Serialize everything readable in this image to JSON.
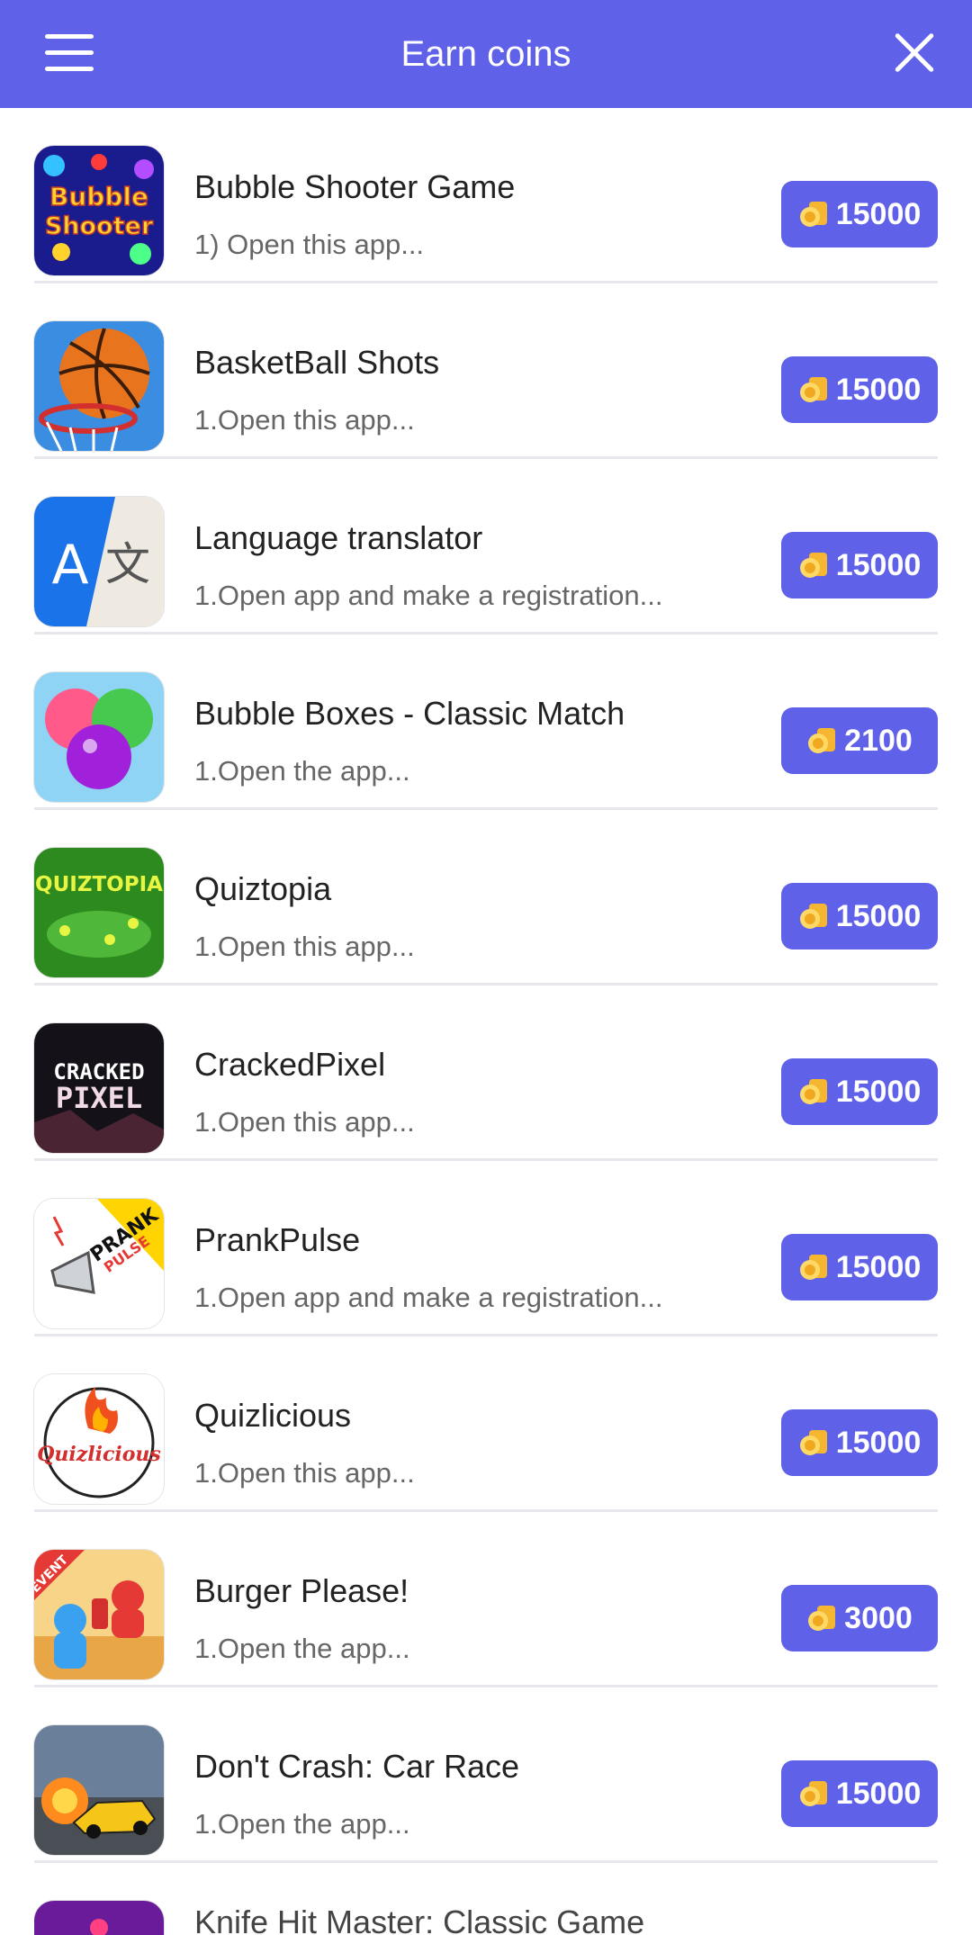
{
  "header": {
    "title": "Earn coins",
    "menu_icon": "hamburger-menu-icon",
    "close_icon": "close-icon"
  },
  "theme": {
    "accent": "#6061e9",
    "divider": "#e6e6ec"
  },
  "offers": [
    {
      "name": "Bubble Shooter Game",
      "desc": "1) Open this app...",
      "reward": "15000"
    },
    {
      "name": "BasketBall Shots",
      "desc": "1.Open this app...",
      "reward": "15000"
    },
    {
      "name": "Language translator",
      "desc": "1.Open app and make a registration...",
      "reward": "15000"
    },
    {
      "name": "Bubble Boxes - Classic Match",
      "desc": "1.Open the app...",
      "reward": "2100"
    },
    {
      "name": "Quiztopia",
      "desc": "1.Open this app...",
      "reward": "15000"
    },
    {
      "name": "CrackedPixel",
      "desc": "1.Open this app...",
      "reward": "15000"
    },
    {
      "name": "PrankPulse",
      "desc": "1.Open app and make a registration...",
      "reward": "15000"
    },
    {
      "name": "Quizlicious",
      "desc": "1.Open this app...",
      "reward": "15000"
    },
    {
      "name": "Burger Please!",
      "desc": "1.Open the app...",
      "reward": "3000"
    },
    {
      "name": "Don't Crash: Car Race",
      "desc": "1.Open the app...",
      "reward": "15000"
    },
    {
      "name": "Knife Hit Master: Classic Game",
      "desc": "",
      "reward": ""
    }
  ],
  "icon_text": {
    "bubble_shooter": [
      "Bubble",
      "Shooter"
    ],
    "translator": [
      "A",
      "文"
    ],
    "quiztopia": [
      "QUIZTOPIA"
    ],
    "cracked_pixel": [
      "CRACKED",
      "PIXEL"
    ],
    "prank_pulse": [
      "PRANK",
      "PULSE"
    ],
    "quizlicious": [
      "Quizlicious"
    ],
    "burger": [
      "EVENT"
    ]
  }
}
